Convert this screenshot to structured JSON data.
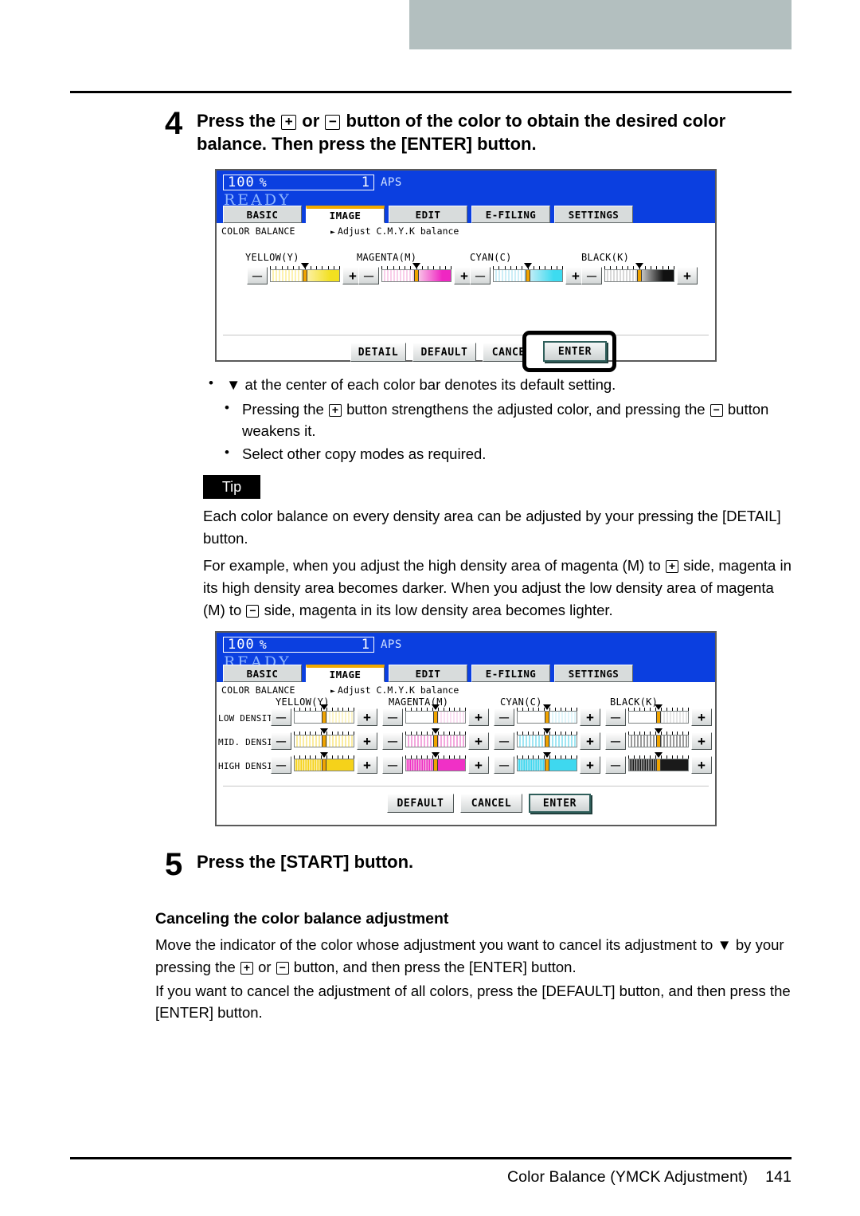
{
  "page": {
    "footer_title": "Color Balance (YMCK Adjustment)",
    "page_number": "141"
  },
  "steps": [
    {
      "number": "4",
      "title_part1": "Press the ",
      "plus": "+",
      "title_part2": " or ",
      "minus": "−",
      "title_part3": " button of the color to obtain the desired color balance. Then press the [ENTER] button."
    },
    {
      "number": "5",
      "title": "Press the [START] button."
    }
  ],
  "bullets": [
    {
      "prefix": "▼",
      "text": " at the center of each color bar denotes its default setting."
    },
    {
      "a": "Pressing the ",
      "plus": "+",
      "b": " button strengthens the adjusted color, and pressing the ",
      "minus": "−",
      "c": " button weakens it."
    },
    {
      "text": "Select other copy modes as required."
    }
  ],
  "tip": {
    "label": "Tip",
    "paragraph1": "Each color balance on every density area can be adjusted by your pressing the [DETAIL] button.",
    "paragraph2_a": "For example, when you adjust the high density area of magenta (M) to ",
    "paragraph2_plus": "+",
    "paragraph2_b": " side, magenta in its high density area becomes darker. When you adjust the low density area of magenta (M) to ",
    "paragraph2_minus": "−",
    "paragraph2_c": " side, magenta in its low density area becomes lighter."
  },
  "canceling": {
    "heading": "Canceling the color balance adjustment",
    "line1_a": "Move the indicator of the color whose adjustment you want to cancel its adjustment to ",
    "line1_marker": "▼",
    "line1_b": " by your pressing the ",
    "line1_plus": "+",
    "line1_c": " or ",
    "line1_minus": "−",
    "line1_d": " button, and then press the [ENTER] button.",
    "line2": "If you want to cancel the adjustment of all colors, press the [DEFAULT] button, and then press the [ENTER] button."
  },
  "lcd1": {
    "zoom_value": "100",
    "zoom_unit": "%",
    "copy_count": "1",
    "paper_mode": "APS",
    "status": "READY",
    "tabs": [
      {
        "label": "BASIC",
        "active": false
      },
      {
        "label": "IMAGE",
        "active": true
      },
      {
        "label": "EDIT",
        "active": false
      },
      {
        "label": "E-FILING",
        "active": false
      },
      {
        "label": "SETTINGS",
        "active": false
      }
    ],
    "breadcrumb": "COLOR BALANCE",
    "breadcrumb_detail": "Adjust C.M.Y.K balance",
    "minus_label": "─",
    "plus_label": "+",
    "sliders": [
      {
        "name": "YELLOW(Y)",
        "color_light": "#fdf2b0",
        "color_strong": "#f2e020"
      },
      {
        "name": "MAGENTA(M)",
        "color_light": "#f9cfea",
        "color_strong": "#ef27c2"
      },
      {
        "name": "CYAN(C)",
        "color_light": "#cdeef7",
        "color_strong": "#3ddbf0"
      },
      {
        "name": "BLACK(K)",
        "color_light": "#d9d9d9",
        "color_strong": "#111111"
      }
    ],
    "buttons": [
      {
        "label": "DETAIL",
        "highlighted": false
      },
      {
        "label": "DEFAULT",
        "highlighted": false
      },
      {
        "label": "CANCEL",
        "highlighted": false
      },
      {
        "label": "ENTER",
        "highlighted": true
      }
    ]
  },
  "lcd2": {
    "zoom_value": "100",
    "zoom_unit": "%",
    "copy_count": "1",
    "paper_mode": "APS",
    "status": "READY",
    "tabs": [
      {
        "label": "BASIC",
        "active": false
      },
      {
        "label": "IMAGE",
        "active": true
      },
      {
        "label": "EDIT",
        "active": false
      },
      {
        "label": "E-FILING",
        "active": false
      },
      {
        "label": "SETTINGS",
        "active": false
      }
    ],
    "breadcrumb": "COLOR BALANCE",
    "breadcrumb_detail": "Adjust C.M.Y.K balance",
    "minus_label": "─",
    "plus_label": "+",
    "columns": [
      {
        "name": "YELLOW(Y)",
        "color_light": "#fdf5c8",
        "color_mid": "#fbecA0",
        "color_strong": "#f5d21a"
      },
      {
        "name": "MAGENTA(M)",
        "color_light": "#fbe0f3",
        "color_mid": "#f3a8dd",
        "color_strong": "#f030c6"
      },
      {
        "name": "CYAN(C)",
        "color_light": "#e0f6fb",
        "color_mid": "#9fe6f3",
        "color_strong": "#3ed8ef"
      },
      {
        "name": "BLACK(K)",
        "color_light": "#e6e6e6",
        "color_mid": "#9a9a9a",
        "color_strong": "#1a1a1a"
      }
    ],
    "rows": [
      {
        "label": "LOW DENSITY",
        "level": "light"
      },
      {
        "label": "MID. DENSITY",
        "level": "mid"
      },
      {
        "label": "HIGH DENSITY",
        "level": "strong"
      }
    ],
    "buttons": [
      {
        "label": "DEFAULT",
        "highlighted": false
      },
      {
        "label": "CANCEL",
        "highlighted": false
      },
      {
        "label": "ENTER",
        "highlighted": true
      }
    ]
  }
}
